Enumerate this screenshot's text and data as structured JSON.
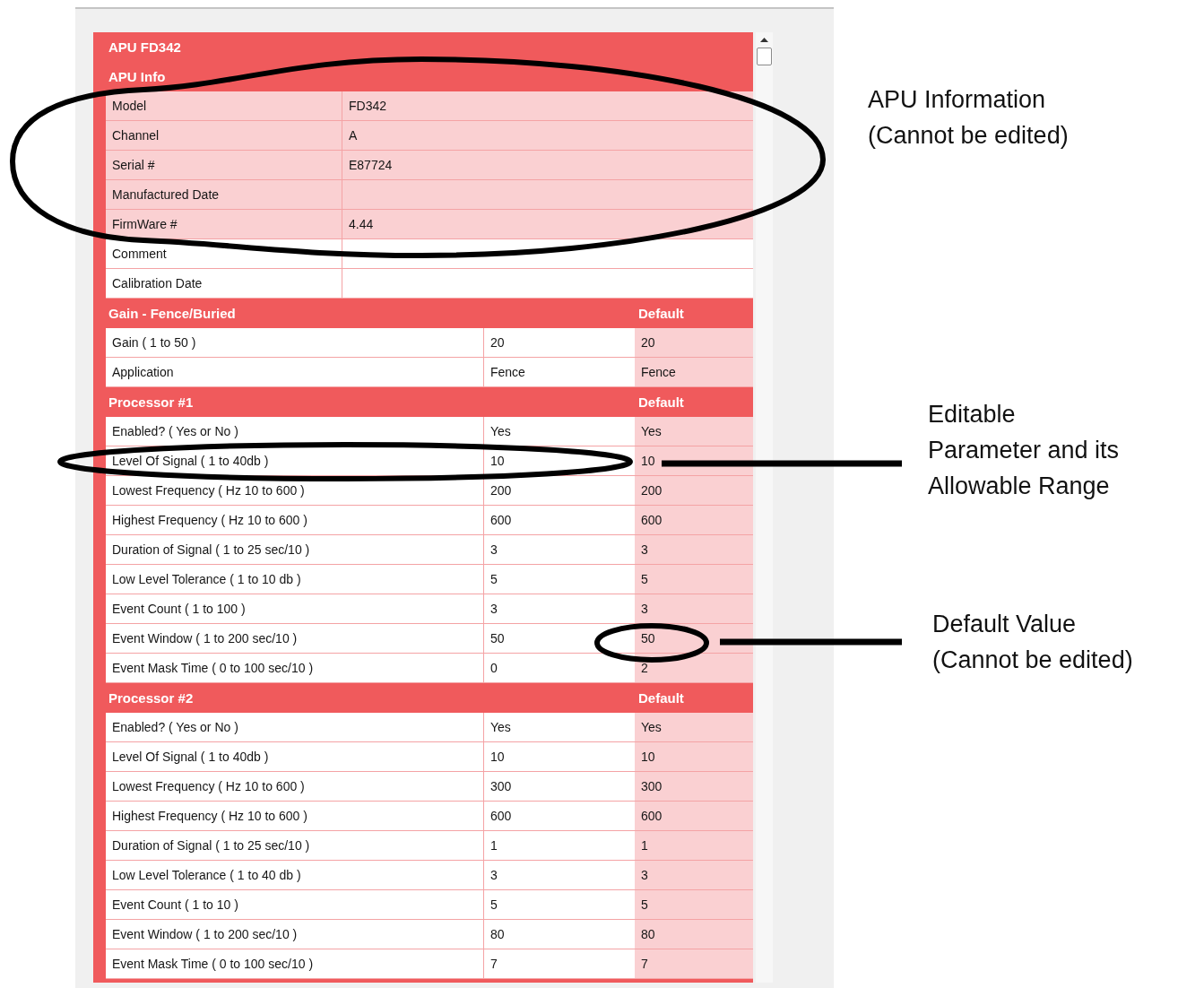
{
  "title": "APU FD342",
  "apu_info": {
    "title": "APU Info",
    "rows": [
      {
        "label": "Model",
        "value": "FD342",
        "read_only": true
      },
      {
        "label": "Channel",
        "value": "A",
        "read_only": true
      },
      {
        "label": "Serial #",
        "value": "E87724",
        "read_only": true
      },
      {
        "label": "Manufactured Date",
        "value": "",
        "read_only": true
      },
      {
        "label": "FirmWare #",
        "value": "4.44",
        "read_only": true
      },
      {
        "label": "Comment",
        "value": "",
        "read_only": false
      },
      {
        "label": "Calibration Date",
        "value": "",
        "read_only": false
      }
    ]
  },
  "sections": [
    {
      "title": "Gain - Fence/Buried",
      "default_header": "Default",
      "rows": [
        {
          "label": "Gain ( 1 to 50 )",
          "value": "20",
          "default": "20"
        },
        {
          "label": "Application",
          "value": "Fence",
          "default": "Fence"
        }
      ]
    },
    {
      "title": "Processor #1",
      "default_header": "Default",
      "rows": [
        {
          "label": "Enabled? ( Yes or No )",
          "value": "Yes",
          "default": "Yes"
        },
        {
          "label": "Level Of Signal ( 1 to 40db )",
          "value": "10",
          "default": "10"
        },
        {
          "label": "Lowest Frequency ( Hz 10 to 600 )",
          "value": "200",
          "default": "200"
        },
        {
          "label": "Highest Frequency ( Hz 10 to 600 )",
          "value": "600",
          "default": "600"
        },
        {
          "label": "Duration of Signal ( 1 to 25 sec/10 )",
          "value": "3",
          "default": "3"
        },
        {
          "label": "Low Level Tolerance ( 1 to 10 db )",
          "value": "5",
          "default": "5"
        },
        {
          "label": "Event Count ( 1 to 100 )",
          "value": "3",
          "default": "3"
        },
        {
          "label": "Event Window ( 1 to 200 sec/10 )",
          "value": "50",
          "default": "50"
        },
        {
          "label": "Event Mask Time ( 0 to 100 sec/10 )",
          "value": "0",
          "default": "2"
        }
      ]
    },
    {
      "title": "Processor #2",
      "default_header": "Default",
      "rows": [
        {
          "label": "Enabled? ( Yes or No )",
          "value": "Yes",
          "default": "Yes"
        },
        {
          "label": "Level Of Signal ( 1 to 40db )",
          "value": "10",
          "default": "10"
        },
        {
          "label": "Lowest Frequency ( Hz 10 to 600 )",
          "value": "300",
          "default": "300"
        },
        {
          "label": "Highest Frequency ( Hz 10 to 600 )",
          "value": "600",
          "default": "600"
        },
        {
          "label": "Duration of Signal ( 1 to 25 sec/10 )",
          "value": "1",
          "default": "1"
        },
        {
          "label": "Low Level Tolerance ( 1 to 40 db )",
          "value": "3",
          "default": "3"
        },
        {
          "label": "Event Count ( 1 to 10 )",
          "value": "5",
          "default": "5"
        },
        {
          "label": "Event Window ( 1 to 200 sec/10 )",
          "value": "80",
          "default": "80"
        },
        {
          "label": "Event Mask Time ( 0 to 100 sec/10 )",
          "value": "7",
          "default": "7"
        }
      ]
    }
  ],
  "callouts": [
    {
      "lines": [
        "APU Information",
        "(Cannot be edited)"
      ]
    },
    {
      "lines": [
        "Editable",
        "Parameter and its",
        "Allowable Range"
      ]
    },
    {
      "lines": [
        "Default Value",
        "(Cannot be edited)"
      ]
    }
  ]
}
